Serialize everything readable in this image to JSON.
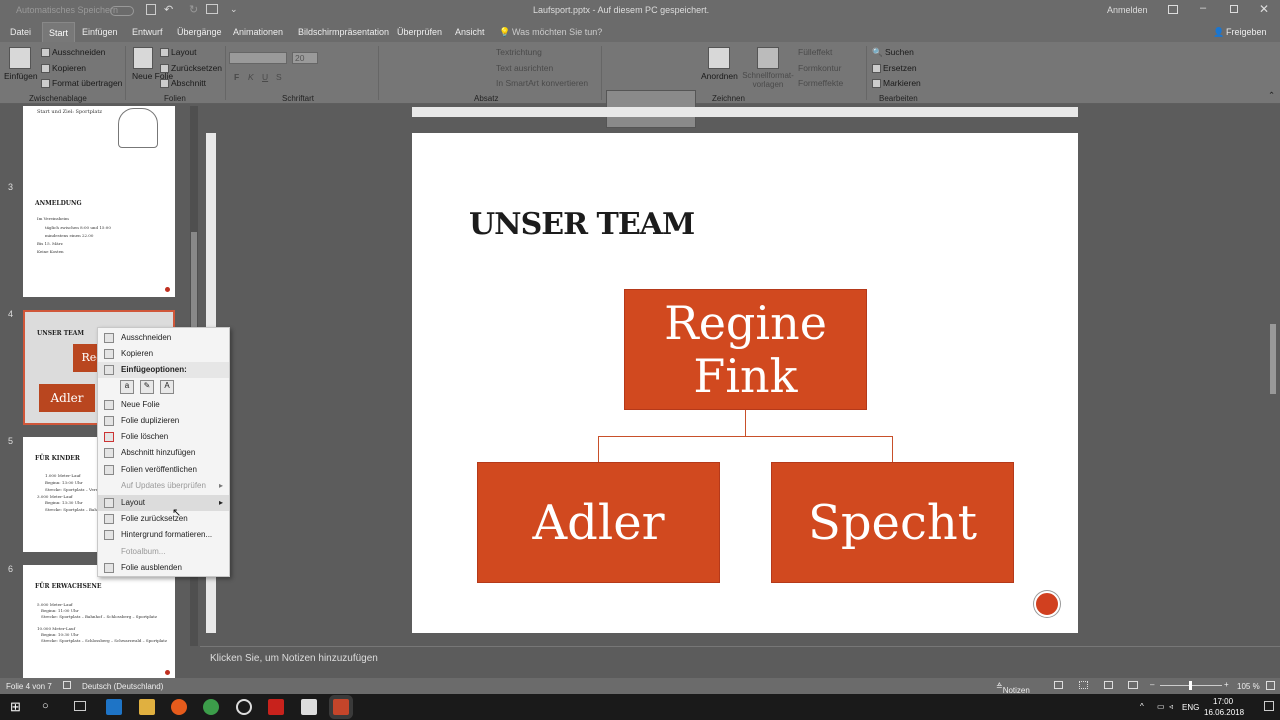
{
  "titlebar": {
    "autosave": "Automatisches Speichern",
    "doc_title": "Laufsport.pptx  -  Auf diesem PC gespeichert.",
    "signin": "Anmelden"
  },
  "ribbon_tabs": [
    "Datei",
    "Start",
    "Einfügen",
    "Entwurf",
    "Übergänge",
    "Animationen",
    "Bildschirmpräsentation",
    "Überprüfen",
    "Ansicht"
  ],
  "tell_me": "Was möchten Sie tun?",
  "share": "Freigeben",
  "ribbon": {
    "paste": "Einfügen",
    "cut": "Ausschneiden",
    "copy": "Kopieren",
    "format_painter": "Format übertragen",
    "clipboard_group": "Zwischenablage",
    "new_slide": "Neue Folie",
    "layout": "Layout",
    "reset": "Zurücksetzen",
    "section": "Abschnitt",
    "slides_group": "Folien",
    "font_size": "20",
    "font_group": "Schriftart",
    "text_direction": "Textrichtung",
    "align_text": "Text ausrichten",
    "smartart": "In SmartArt konvertieren",
    "paragraph_group": "Absatz",
    "arrange": "Anordnen",
    "quick_styles": "Schnellformat-vorlagen",
    "fill": "Fülleffekt",
    "outline": "Formkontur",
    "effects": "Formeffekte",
    "drawing_group": "Zeichnen",
    "find": "Suchen",
    "replace": "Ersetzen",
    "select": "Markieren",
    "editing_group": "Bearbeiten"
  },
  "thumbnails": {
    "slide2_text": "Start und Ziel: Sportplatz",
    "slide3_num": "3",
    "slide3_title": "ANMELDUNG",
    "slide3_lines": [
      "Im Vereinsheim",
      "täglich zwischen 8:00 und 15:00",
      "mindestens einen 22.00",
      "Bis 15. März",
      "Keine Kosten"
    ],
    "slide4_num": "4",
    "slide4_title": "UNSER TEAM",
    "slide4_top": "Regine Fink",
    "slide4_left": "Adler",
    "slide5_num": "5",
    "slide5_title": "FÜR KINDER",
    "slide5_lines": [
      "1.000 Meter-Lauf",
      "Beginn: 13:00 Uhr",
      "Strecke: Sportplatz – Vereinsheim",
      "3.000 Meter-Lauf",
      "Beginn: 13:30 Uhr",
      "Strecke: Sportplatz – Bahnhof –"
    ],
    "slide6_num": "6",
    "slide6_title": "FÜR ERWACHSENE",
    "slide6_lines": [
      "5.000 Meter-Lauf",
      "Beginn: 11:00 Uhr",
      "Strecke: Sportplatz – Bahnhof – Schlossberg – Sportplatz",
      "10.000 Meter-Lauf",
      "Beginn: 10:30 Uhr",
      "Strecke: Sportplatz – Schlossberg – Schwarzwald – Sportplatz"
    ]
  },
  "slide": {
    "title": "UNSER TEAM",
    "top_node": "Regine Fink",
    "left_node": "Adler",
    "right_node": "Specht"
  },
  "context_menu": {
    "items": [
      "Ausschneiden",
      "Kopieren",
      "Einfügeoptionen:",
      "Neue Folie",
      "Folie duplizieren",
      "Folie löschen",
      "Abschnitt hinzufügen",
      "Folien veröffentlichen",
      "Auf Updates überprüfen",
      "Layout",
      "Folie zurücksetzen",
      "Hintergrund formatieren...",
      "Fotoalbum...",
      "Folie ausblenden"
    ]
  },
  "notes_placeholder": "Klicken Sie, um Notizen hinzuzufügen",
  "statusbar": {
    "slide_of": "Folie 4 von 7",
    "language": "Deutsch (Deutschland)",
    "notes": "Notizen",
    "zoom": "105 %"
  },
  "taskbar": {
    "lang": "ENG",
    "time": "17:00",
    "date": "16.06.2018"
  }
}
